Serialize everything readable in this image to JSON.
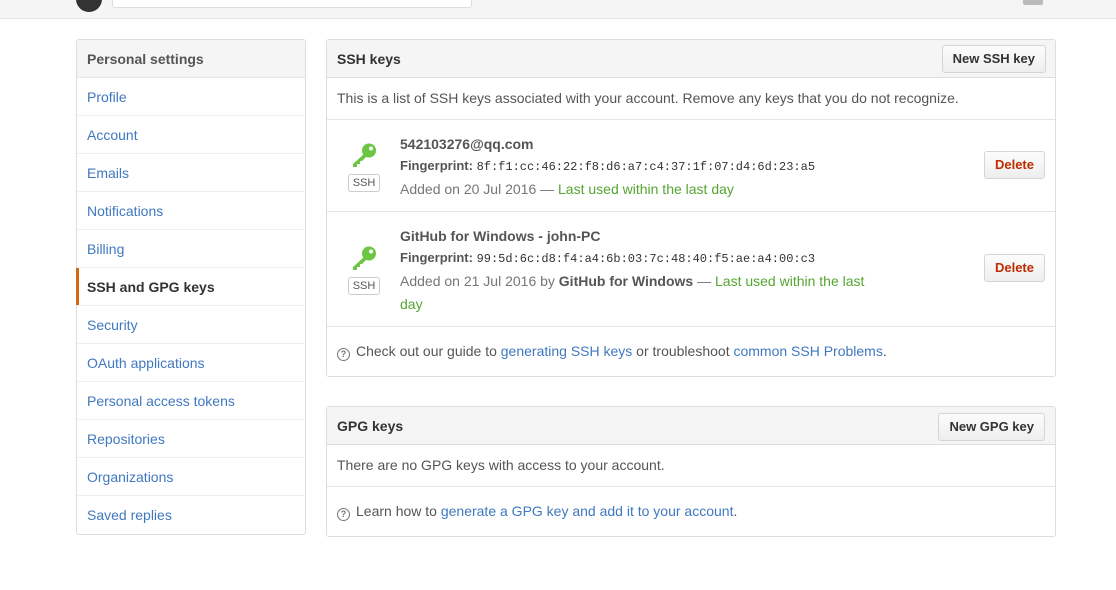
{
  "sidebar": {
    "heading": "Personal settings",
    "items": [
      {
        "label": "Profile"
      },
      {
        "label": "Account"
      },
      {
        "label": "Emails"
      },
      {
        "label": "Notifications"
      },
      {
        "label": "Billing"
      },
      {
        "label": "SSH and GPG keys",
        "selected": true
      },
      {
        "label": "Security"
      },
      {
        "label": "OAuth applications"
      },
      {
        "label": "Personal access tokens"
      },
      {
        "label": "Repositories"
      },
      {
        "label": "Organizations"
      },
      {
        "label": "Saved replies"
      }
    ]
  },
  "ssh": {
    "title": "SSH keys",
    "new_button": "New SSH key",
    "description": "This is a list of SSH keys associated with your account. Remove any keys that you do not recognize.",
    "keys": [
      {
        "name": "542103276@qq.com",
        "fingerprint_label": "Fingerprint:",
        "fingerprint": "8f:f1:cc:46:22:f8:d6:a7:c4:37:1f:07:d4:6d:23:a5",
        "added_prefix": "Added on 20 Jul 2016 — ",
        "last_used": "Last used within the last day",
        "type_label": "SSH",
        "delete_label": "Delete"
      },
      {
        "name": "GitHub for Windows - john-PC",
        "fingerprint_label": "Fingerprint:",
        "fingerprint": "99:5d:6c:d8:f4:a4:6b:03:7c:48:40:f5:ae:a4:00:c3",
        "added_prefix": "Added on 21 Jul 2016 by ",
        "added_by": "GitHub for Windows",
        "added_sep": " — ",
        "last_used": "Last used within the last day",
        "type_label": "SSH",
        "delete_label": "Delete"
      }
    ],
    "help_prefix": "Check out our guide to ",
    "help_link1": "generating SSH keys",
    "help_middle": " or troubleshoot ",
    "help_link2": "common SSH Problems",
    "help_suffix": "."
  },
  "gpg": {
    "title": "GPG keys",
    "new_button": "New GPG key",
    "empty_text": "There are no GPG keys with access to your account.",
    "help_prefix": "Learn how to ",
    "help_link": "generate a GPG key and add it to your account",
    "help_suffix": "."
  },
  "icons": {
    "key": "key-icon",
    "help": "question-circle-icon",
    "logo": "github-logo-icon"
  },
  "colors": {
    "link": "#4078c0",
    "selected_accent": "#d26911",
    "key_green": "#6cc644",
    "last_used": "#55a532",
    "danger": "#bd2c00"
  }
}
